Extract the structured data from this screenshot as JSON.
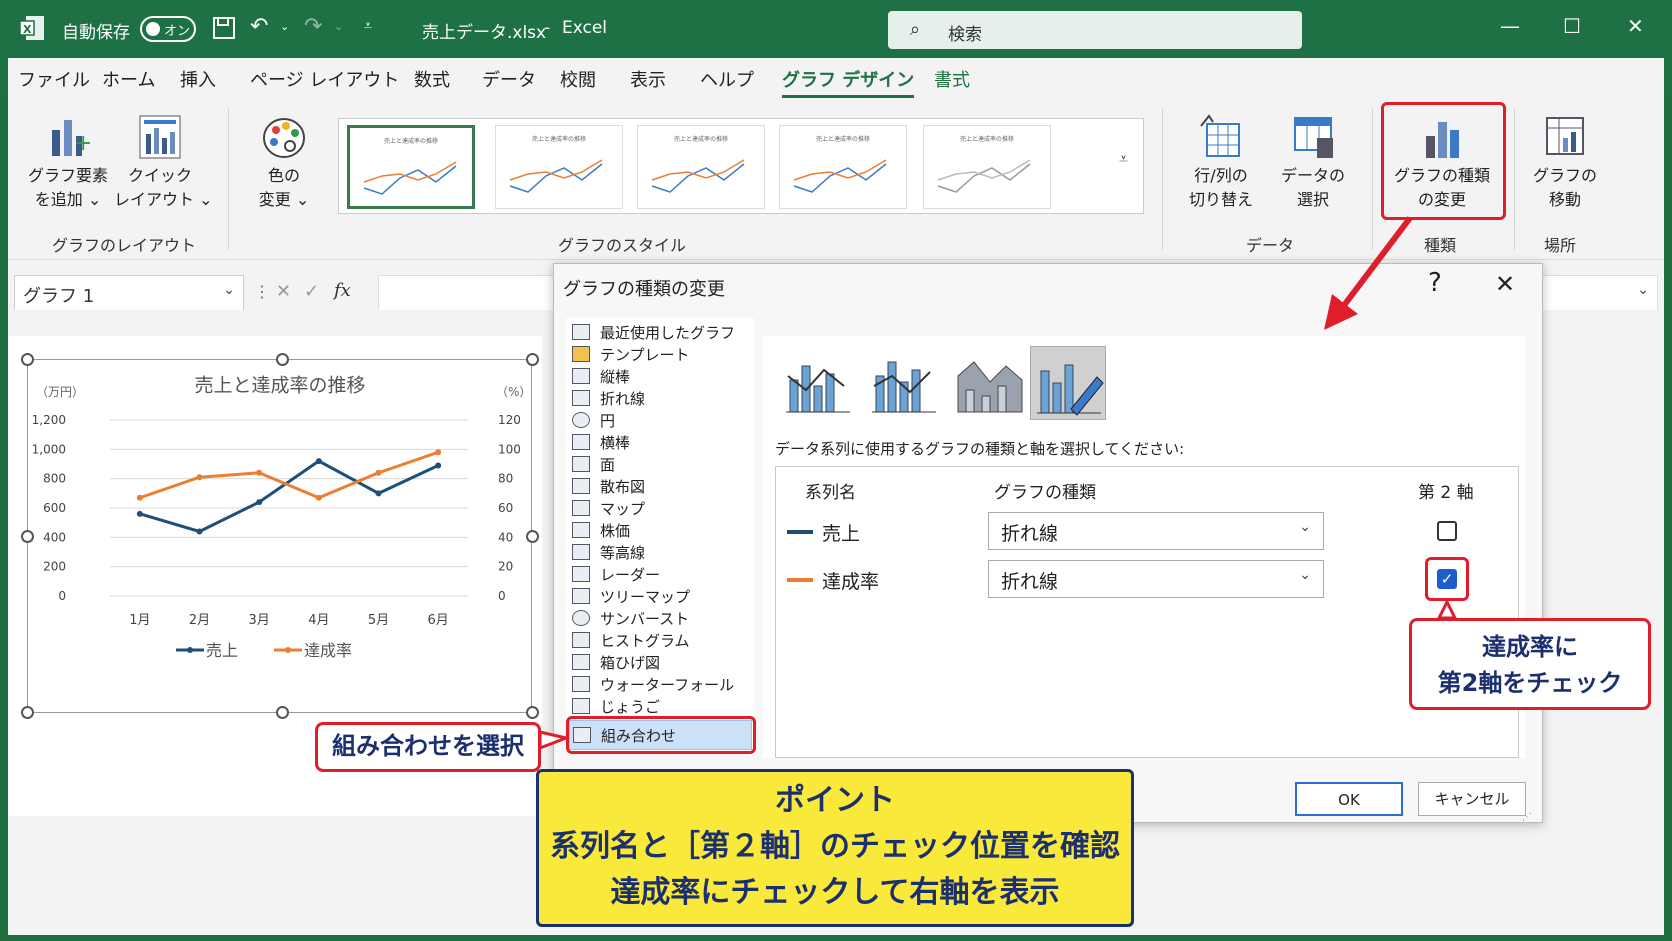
{
  "titlebar": {
    "autosave_label": "自動保存",
    "toggle_label": "オン",
    "filename": "売上データ.xlsx",
    "sep": "-",
    "app": "Excel",
    "search_placeholder": "検索"
  },
  "menu_tabs": [
    "ファイル",
    "ホーム",
    "挿入",
    "ページ レイアウト",
    "数式",
    "データ",
    "校閲",
    "表示",
    "ヘルプ",
    "グラフ デザイン",
    "書式"
  ],
  "ribbon": {
    "add_element_1": "グラフ要素",
    "add_element_2": "を追加 ⌄",
    "quick_layout_1": "クイック",
    "quick_layout_2": "レイアウト ⌄",
    "color_1": "色の",
    "color_2": "変更 ⌄",
    "switch_1": "行/列の",
    "switch_2": "切り替え",
    "select_data_1": "データの",
    "select_data_2": "選択",
    "change_type_1": "グラフの種類",
    "change_type_2": "の変更",
    "move_1": "グラフの",
    "move_2": "移動",
    "group_layout": "グラフのレイアウト",
    "group_style": "グラフのスタイル",
    "group_data": "データ",
    "group_type": "種類",
    "group_location": "場所",
    "thumb_title": "売上と達成率の推移"
  },
  "formula": {
    "namebox": "グラフ 1",
    "fx": "fx"
  },
  "chart_data": {
    "type": "line",
    "title": "売上と達成率の推移",
    "ylabel_left": "（万円）",
    "ylabel_right": "（%）",
    "categories": [
      "1月",
      "2月",
      "3月",
      "4月",
      "5月",
      "6月"
    ],
    "left_ticks": [
      "1,200",
      "1,000",
      "800",
      "600",
      "400",
      "200",
      "0"
    ],
    "right_ticks": [
      "120",
      "100",
      "80",
      "60",
      "40",
      "20",
      "0"
    ],
    "ylim_left": [
      0,
      1200
    ],
    "ylim_right": [
      0,
      120
    ],
    "grid": true,
    "legend": "bottom",
    "series": [
      {
        "name": "売上",
        "axis": "left",
        "color": "#1f4e79",
        "values": [
          560,
          440,
          640,
          920,
          700,
          890
        ]
      },
      {
        "name": "達成率",
        "axis": "right",
        "color": "#ed7d31",
        "values": [
          67,
          81,
          84,
          67,
          84,
          98
        ]
      }
    ]
  },
  "dialog": {
    "title": "グラフの種類の変更",
    "help": "?",
    "close": "✕",
    "categories": [
      "最近使用したグラフ",
      "テンプレート",
      "縦棒",
      "折れ線",
      "円",
      "横棒",
      "面",
      "散布図",
      "マップ",
      "株価",
      "等高線",
      "レーダー",
      "ツリーマップ",
      "サンバースト",
      "ヒストグラム",
      "箱ひげ図",
      "ウォーターフォール",
      "じょうご",
      "組み合わせ"
    ],
    "selected_category": "組み合わせ",
    "instruction": "データ系列に使用するグラフの種類と軸を選択してください:",
    "col_series": "系列名",
    "col_type": "グラフの種類",
    "col_axis": "第 2 軸",
    "rows": [
      {
        "name": "売上",
        "type": "折れ線",
        "secondary": false,
        "color": "#1f4e79"
      },
      {
        "name": "達成率",
        "type": "折れ線",
        "secondary": true,
        "color": "#ed7d31"
      }
    ],
    "ok": "OK",
    "cancel": "キャンセル"
  },
  "annotations": {
    "combo_callout": "組み合わせを選択",
    "axis_callout_1": "達成率に",
    "axis_callout_2": "第2軸をチェック",
    "point_1": "ポイント",
    "point_2": "系列名と［第２軸］のチェック位置を確認",
    "point_3": "達成率にチェックして右軸を表示"
  },
  "colors": {
    "excel_green": "#1e7145",
    "callout_red": "#e01d2b",
    "point_yellow": "#f9e93a",
    "navy": "#1c2f6e"
  }
}
